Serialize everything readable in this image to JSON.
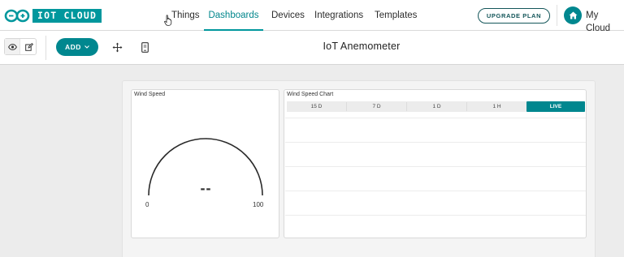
{
  "header": {
    "logo_text": "IOT CLOUD",
    "nav": [
      {
        "label": "Things",
        "active": false
      },
      {
        "label": "Dashboards",
        "active": true
      },
      {
        "label": "Devices",
        "active": false
      },
      {
        "label": "Integrations",
        "active": false
      },
      {
        "label": "Templates",
        "active": false
      }
    ],
    "upgrade_label": "UPGRADE PLAN",
    "space_label": "My Cloud"
  },
  "toolbar": {
    "add_label": "ADD",
    "dashboard_title": "IoT Anemometer"
  },
  "widgets": {
    "gauge": {
      "title": "Wind Speed",
      "value": "--",
      "min": "0",
      "max": "100"
    },
    "chart": {
      "title": "Wind Speed Chart",
      "ranges": [
        "15 D",
        "7 D",
        "1 D",
        "1 H",
        "LIVE"
      ],
      "active_range": "LIVE"
    }
  },
  "colors": {
    "accent": "#00979d",
    "accent_dark": "#00878f",
    "upgrade_border": "#14565a"
  }
}
